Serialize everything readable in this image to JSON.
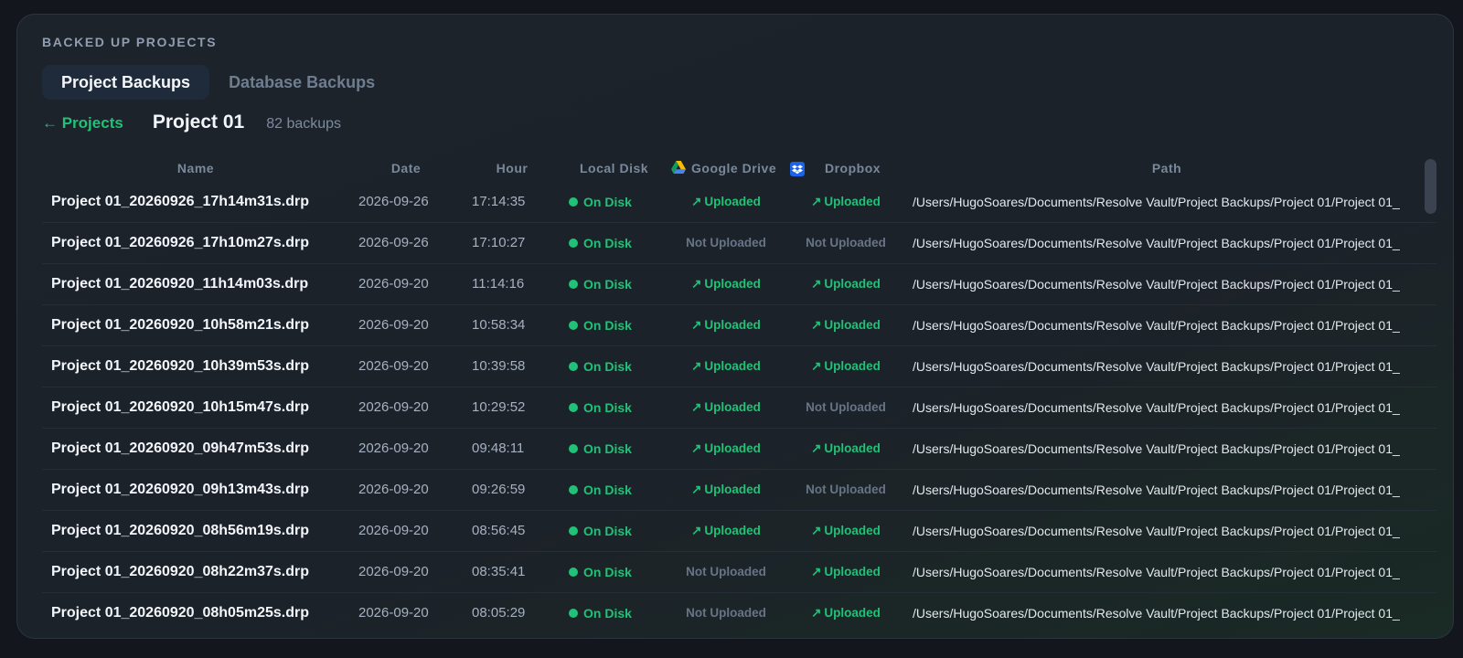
{
  "section_title": "BACKED UP PROJECTS",
  "tabs": [
    {
      "label": "Project Backups",
      "active": true
    },
    {
      "label": "Database Backups",
      "active": false
    }
  ],
  "breadcrumb": {
    "back_label": "← Projects",
    "project_title": "Project 01",
    "backup_count": "82 backups"
  },
  "table": {
    "columns": {
      "name": "Name",
      "date": "Date",
      "hour": "Hour",
      "local_disk": "Local Disk",
      "google_drive": "Google Drive",
      "dropbox": "Dropbox",
      "path": "Path"
    },
    "rows": [
      {
        "name": "Project 01_20260926_17h14m31s.drp",
        "date": "2026-09-26",
        "hour": "17:14:35",
        "local": "On Disk",
        "gdrive": "Uploaded",
        "dropbox": "Uploaded",
        "path": "/Users/HugoSoares/Documents/Resolve Vault/Project Backups/Project 01/Project 01_"
      },
      {
        "name": "Project 01_20260926_17h10m27s.drp",
        "date": "2026-09-26",
        "hour": "17:10:27",
        "local": "On Disk",
        "gdrive": "Not Uploaded",
        "dropbox": "Not Uploaded",
        "path": "/Users/HugoSoares/Documents/Resolve Vault/Project Backups/Project 01/Project 01_"
      },
      {
        "name": "Project 01_20260920_11h14m03s.drp",
        "date": "2026-09-20",
        "hour": "11:14:16",
        "local": "On Disk",
        "gdrive": "Uploaded",
        "dropbox": "Uploaded",
        "path": "/Users/HugoSoares/Documents/Resolve Vault/Project Backups/Project 01/Project 01_"
      },
      {
        "name": "Project 01_20260920_10h58m21s.drp",
        "date": "2026-09-20",
        "hour": "10:58:34",
        "local": "On Disk",
        "gdrive": "Uploaded",
        "dropbox": "Uploaded",
        "path": "/Users/HugoSoares/Documents/Resolve Vault/Project Backups/Project 01/Project 01_"
      },
      {
        "name": "Project 01_20260920_10h39m53s.drp",
        "date": "2026-09-20",
        "hour": "10:39:58",
        "local": "On Disk",
        "gdrive": "Uploaded",
        "dropbox": "Uploaded",
        "path": "/Users/HugoSoares/Documents/Resolve Vault/Project Backups/Project 01/Project 01_"
      },
      {
        "name": "Project 01_20260920_10h15m47s.drp",
        "date": "2026-09-20",
        "hour": "10:29:52",
        "local": "On Disk",
        "gdrive": "Uploaded",
        "dropbox": "Not Uploaded",
        "path": "/Users/HugoSoares/Documents/Resolve Vault/Project Backups/Project 01/Project 01_"
      },
      {
        "name": "Project 01_20260920_09h47m53s.drp",
        "date": "2026-09-20",
        "hour": "09:48:11",
        "local": "On Disk",
        "gdrive": "Uploaded",
        "dropbox": "Uploaded",
        "path": "/Users/HugoSoares/Documents/Resolve Vault/Project Backups/Project 01/Project 01_"
      },
      {
        "name": "Project 01_20260920_09h13m43s.drp",
        "date": "2026-09-20",
        "hour": "09:26:59",
        "local": "On Disk",
        "gdrive": "Uploaded",
        "dropbox": "Not Uploaded",
        "path": "/Users/HugoSoares/Documents/Resolve Vault/Project Backups/Project 01/Project 01_"
      },
      {
        "name": "Project 01_20260920_08h56m19s.drp",
        "date": "2026-09-20",
        "hour": "08:56:45",
        "local": "On Disk",
        "gdrive": "Uploaded",
        "dropbox": "Uploaded",
        "path": "/Users/HugoSoares/Documents/Resolve Vault/Project Backups/Project 01/Project 01_"
      },
      {
        "name": "Project 01_20260920_08h22m37s.drp",
        "date": "2026-09-20",
        "hour": "08:35:41",
        "local": "On Disk",
        "gdrive": "Not Uploaded",
        "dropbox": "Uploaded",
        "path": "/Users/HugoSoares/Documents/Resolve Vault/Project Backups/Project 01/Project 01_"
      },
      {
        "name": "Project 01_20260920_08h05m25s.drp",
        "date": "2026-09-20",
        "hour": "08:05:29",
        "local": "On Disk",
        "gdrive": "Not Uploaded",
        "dropbox": "Uploaded",
        "path": "/Users/HugoSoares/Documents/Resolve Vault/Project Backups/Project 01/Project 01_"
      }
    ]
  },
  "icons": {
    "back": "arrow-left-icon",
    "google_drive": "google-drive-icon",
    "dropbox": "dropbox-icon",
    "uploaded": "arrow-up-right-icon",
    "on_disk": "status-dot-icon"
  },
  "colors": {
    "accent_green": "#1fc277",
    "muted": "#677487",
    "dropbox_blue": "#1b63e8",
    "background": "#13171d"
  }
}
